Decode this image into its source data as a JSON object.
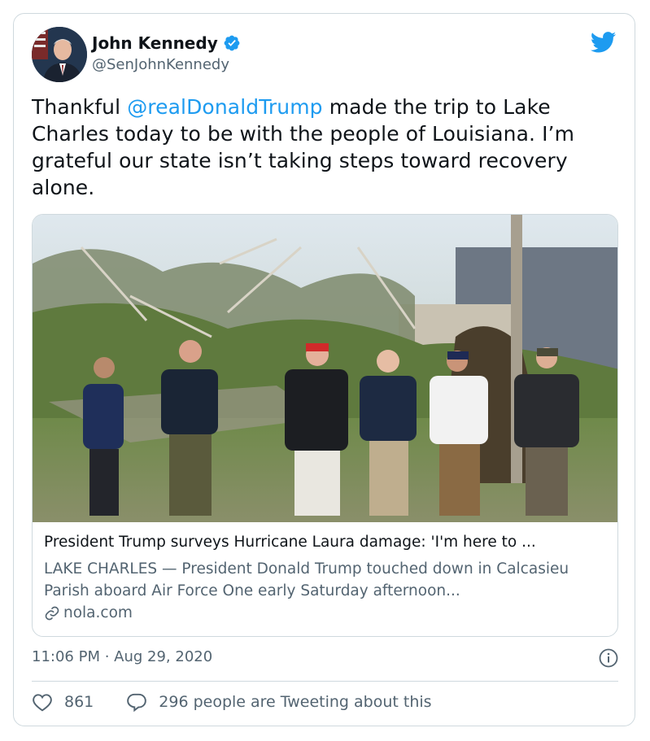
{
  "author": {
    "display_name": "John Kennedy",
    "handle": "@SenJohnKennedy",
    "verified": true
  },
  "tweet": {
    "text_before": "Thankful ",
    "mention": "@realDonaldTrump",
    "text_after": " made the trip to Lake Charles today to be with the people of Louisiana. I’m grateful our state isn’t taking steps toward recovery alone."
  },
  "link_card": {
    "title": "President Trump surveys Hurricane Laura damage: 'I'm here to ...",
    "description": "LAKE CHARLES — President Donald Trump touched down in Calcasieu Parish aboard Air Force One early Saturday afternoon...",
    "domain": "nola.com"
  },
  "meta": {
    "timestamp": "11:06 PM · Aug 29, 2020"
  },
  "engagement": {
    "likes": "861",
    "conversation": "296 people are Tweeting about this"
  },
  "colors": {
    "accent": "#1d9bf0",
    "text": "#0f1419",
    "secondary": "#536471",
    "border": "#cfd9de"
  },
  "icons": [
    "twitter-bird-icon",
    "verified-badge-icon",
    "link-icon",
    "info-icon",
    "heart-icon",
    "reply-bubble-icon"
  ]
}
